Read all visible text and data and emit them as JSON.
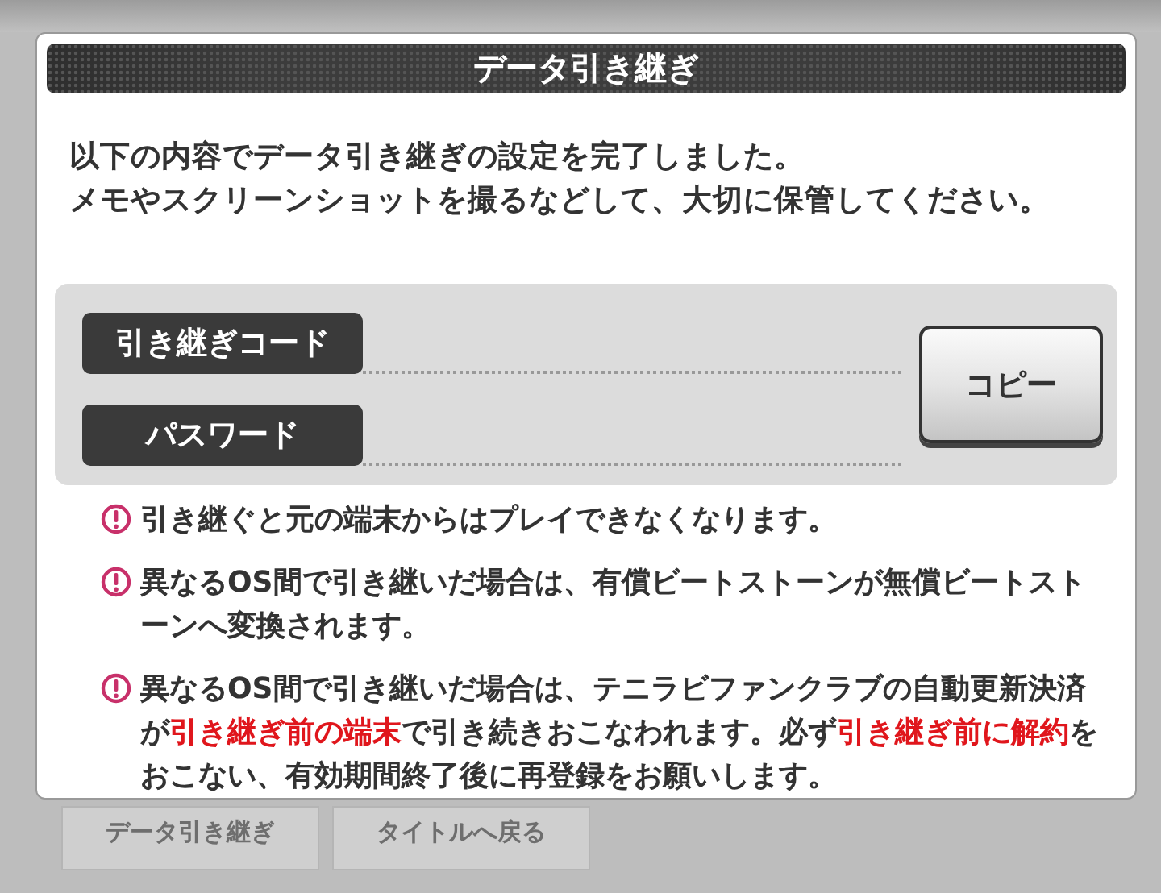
{
  "dialog": {
    "title": "データ引き継ぎ",
    "message": [
      "以下の内容でデータ引き継ぎの設定を完了しました。",
      "メモやスクリーンショットを撮るなどして、大切に保管してください。"
    ],
    "fields": [
      {
        "label": "引き継ぎコード"
      },
      {
        "label": "パスワード"
      }
    ],
    "copy_button": "コピー",
    "notes": [
      {
        "text": "引き継ぐと元の端末からはプレイできなくなります。"
      },
      {
        "text": "異なるOS間で引き継いだ場合は、有償ビートストーンが無償ビートストーンへ変換されます。"
      },
      {
        "text": "異なるOS間で引き継いだ場合は、テニラビファンクラブの自動更新決済が**引き継ぎ前の端末**で引き続きおこなわれます。必ず**引き継ぎ前に解約**をおこない、有効期間終了後に再登録をお願いします。"
      }
    ]
  },
  "background_tabs": [
    {
      "label": "データ引き継ぎ"
    },
    {
      "label": "タイトルへ戻る"
    }
  ]
}
